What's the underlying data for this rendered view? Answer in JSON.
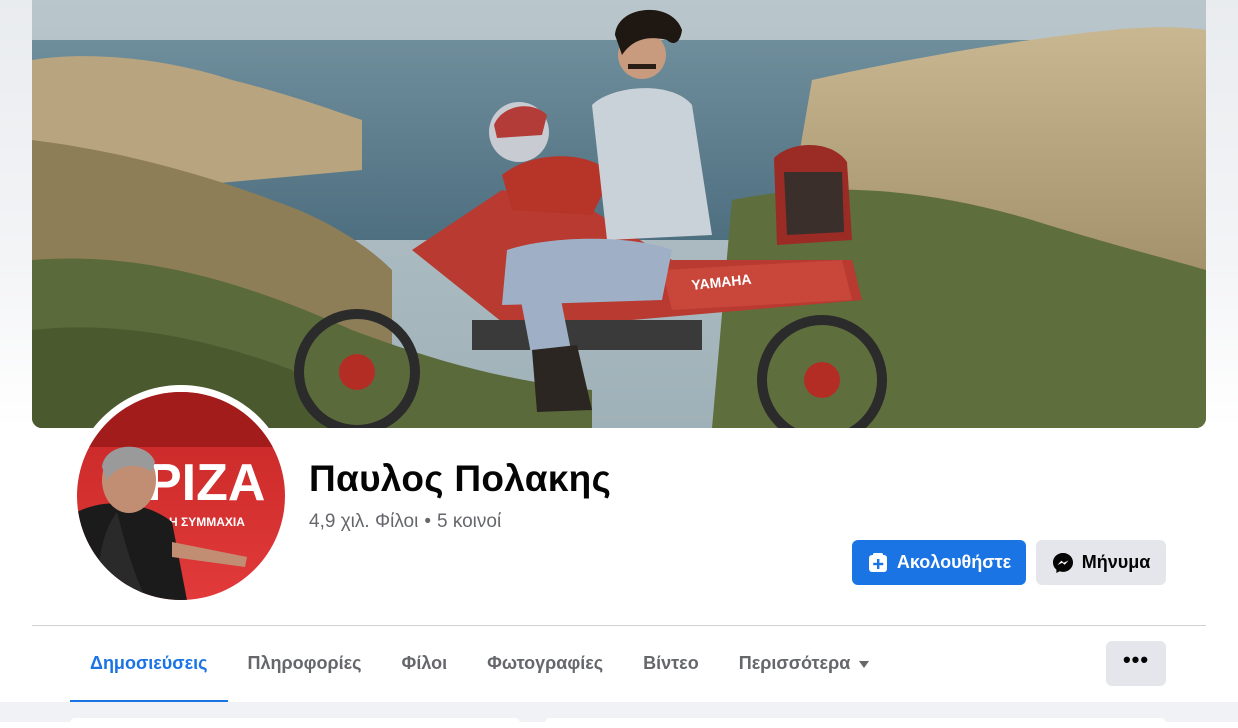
{
  "profile": {
    "name": "Παυλος Πολακης",
    "friends_count": "4,9 χιλ. Φίλοι",
    "separator": "•",
    "mutual": "5 κοινοί"
  },
  "actions": {
    "follow_label": "Ακολουθήστε",
    "message_label": "Μήνυμα",
    "more_label": "•••"
  },
  "tabs": [
    {
      "label": "Δημοσιεύσεις",
      "active": true
    },
    {
      "label": "Πληροφορίες",
      "active": false
    },
    {
      "label": "Φίλοι",
      "active": false
    },
    {
      "label": "Φωτογραφίες",
      "active": false
    },
    {
      "label": "Βίντεο",
      "active": false
    },
    {
      "label": "Περισσότερα",
      "active": false
    }
  ],
  "avatar": {
    "banner_text": "ΡΙΖΑ",
    "banner_subtext": "Η ΣΥΜΜΑΧΙΑ"
  },
  "cover": {
    "bike_text": "YAMAHA"
  },
  "icons": {
    "follow": "add-follow-icon",
    "message": "messenger-icon",
    "more_tab": "caret-down-icon"
  },
  "colors": {
    "accent": "#1b74e4",
    "text_primary": "#050505",
    "text_secondary": "#65676b",
    "button_gray": "#e4e6eb"
  }
}
